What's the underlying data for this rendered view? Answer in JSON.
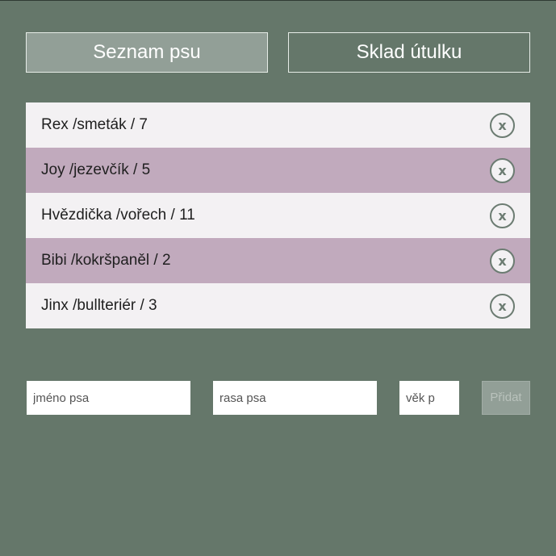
{
  "tabs": {
    "dog_list_label": "Seznam psu",
    "shelter_storage_label": "Sklad útulku"
  },
  "dogs": [
    {
      "text": "Rex /smeták / 7",
      "remove_label": "x"
    },
    {
      "text": "Joy /jezevčík / 5",
      "remove_label": "x"
    },
    {
      "text": "Hvězdička /vořech / 11",
      "remove_label": "x"
    },
    {
      "text": "Bibi /kokršpaněl / 2",
      "remove_label": "x"
    },
    {
      "text": "Jinx /bullteriér / 3",
      "remove_label": "x"
    }
  ],
  "form": {
    "name_placeholder": "jméno psa",
    "breed_placeholder": "rasa psa",
    "age_placeholder": "věk p",
    "name_value": "",
    "breed_value": "",
    "age_value": "",
    "add_label": "Přidat"
  },
  "colors": {
    "background": "#65776a",
    "active_tab": "#929f97",
    "row_light": "#f3f1f3",
    "row_mauve": "#c1aabd",
    "remove_icon": "#6c7c72"
  },
  "icons": {
    "remove": "close-circle-icon"
  }
}
